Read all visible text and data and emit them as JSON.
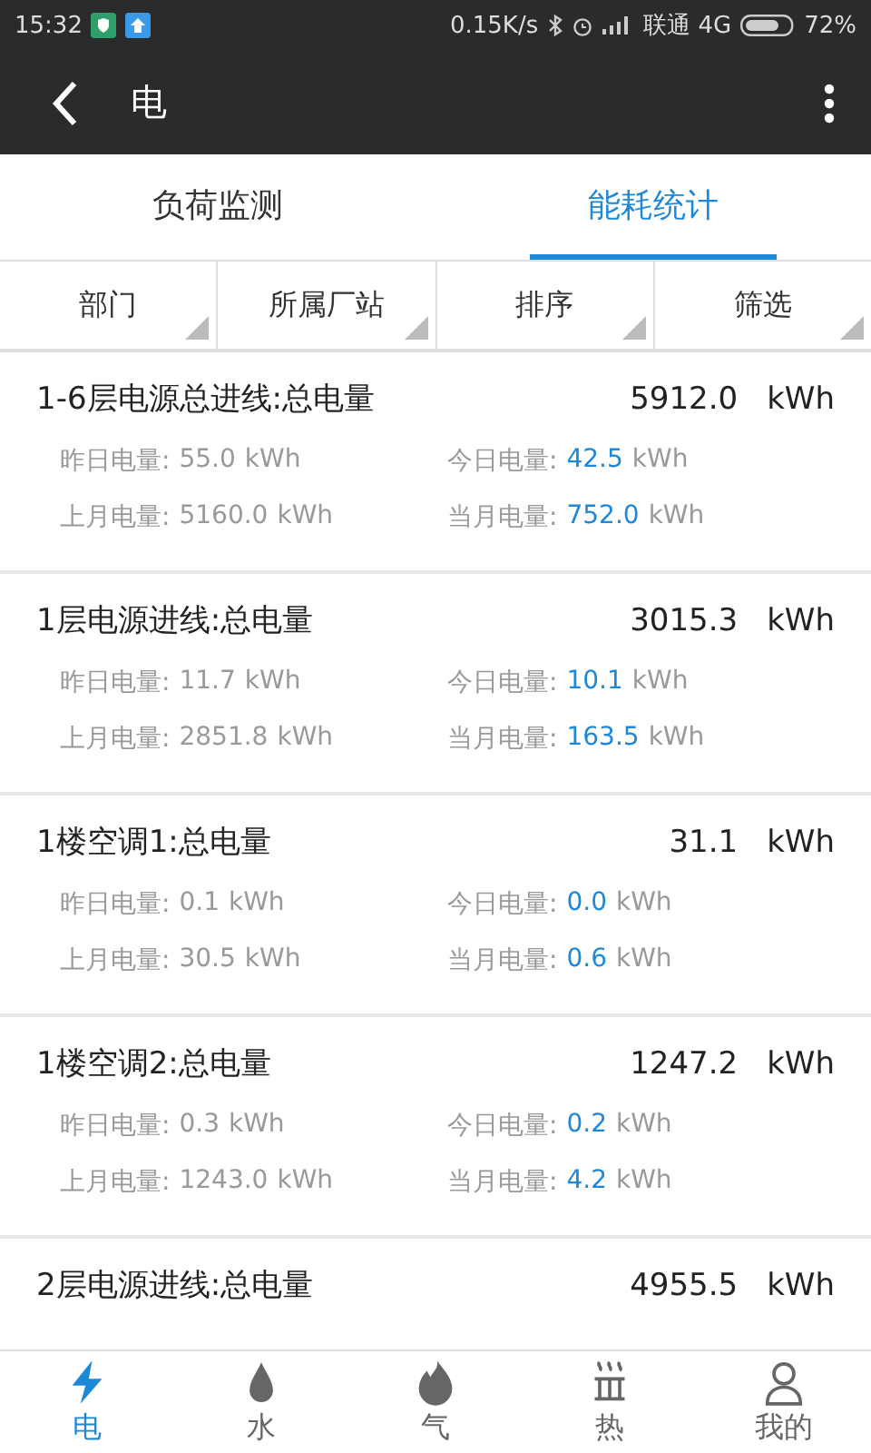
{
  "status_bar": {
    "time": "15:32",
    "speed": "0.15K/s",
    "carrier": "联通 4G",
    "battery": "72%"
  },
  "app_bar": {
    "title": "电"
  },
  "tabs": [
    {
      "label": "负荷监测",
      "selected": false
    },
    {
      "label": "能耗统计",
      "selected": true
    }
  ],
  "filters": [
    "部门",
    "所属厂站",
    "排序",
    "筛选"
  ],
  "items": [
    {
      "name": "1-6层电源总进线:总电量",
      "total": "5912.0",
      "unit": "kWh",
      "stats": [
        {
          "label": "昨日电量:",
          "value": "55.0",
          "unit": "kWh",
          "kind": "past"
        },
        {
          "label": "今日电量:",
          "value": "42.5",
          "unit": "kWh",
          "kind": "current"
        },
        {
          "label": "上月电量:",
          "value": "5160.0",
          "unit": "kWh",
          "kind": "past"
        },
        {
          "label": "当月电量:",
          "value": "752.0",
          "unit": "kWh",
          "kind": "current"
        }
      ]
    },
    {
      "name": "1层电源进线:总电量",
      "total": "3015.3",
      "unit": "kWh",
      "stats": [
        {
          "label": "昨日电量:",
          "value": "11.7",
          "unit": "kWh",
          "kind": "past"
        },
        {
          "label": "今日电量:",
          "value": "10.1",
          "unit": "kWh",
          "kind": "current"
        },
        {
          "label": "上月电量:",
          "value": "2851.8",
          "unit": "kWh",
          "kind": "past"
        },
        {
          "label": "当月电量:",
          "value": "163.5",
          "unit": "kWh",
          "kind": "current"
        }
      ]
    },
    {
      "name": "1楼空调1:总电量",
      "total": "31.1",
      "unit": "kWh",
      "stats": [
        {
          "label": "昨日电量:",
          "value": "0.1",
          "unit": "kWh",
          "kind": "past"
        },
        {
          "label": "今日电量:",
          "value": "0.0",
          "unit": "kWh",
          "kind": "current"
        },
        {
          "label": "上月电量:",
          "value": "30.5",
          "unit": "kWh",
          "kind": "past"
        },
        {
          "label": "当月电量:",
          "value": "0.6",
          "unit": "kWh",
          "kind": "current"
        }
      ]
    },
    {
      "name": "1楼空调2:总电量",
      "total": "1247.2",
      "unit": "kWh",
      "stats": [
        {
          "label": "昨日电量:",
          "value": "0.3",
          "unit": "kWh",
          "kind": "past"
        },
        {
          "label": "今日电量:",
          "value": "0.2",
          "unit": "kWh",
          "kind": "current"
        },
        {
          "label": "上月电量:",
          "value": "1243.0",
          "unit": "kWh",
          "kind": "past"
        },
        {
          "label": "当月电量:",
          "value": "4.2",
          "unit": "kWh",
          "kind": "current"
        }
      ]
    },
    {
      "name": "2层电源进线:总电量",
      "total": "4955.5",
      "unit": "kWh"
    }
  ],
  "bottom_nav": [
    {
      "label": "电",
      "selected": true
    },
    {
      "label": "水",
      "selected": false
    },
    {
      "label": "气",
      "selected": false
    },
    {
      "label": "热",
      "selected": false
    },
    {
      "label": "我的",
      "selected": false
    }
  ]
}
